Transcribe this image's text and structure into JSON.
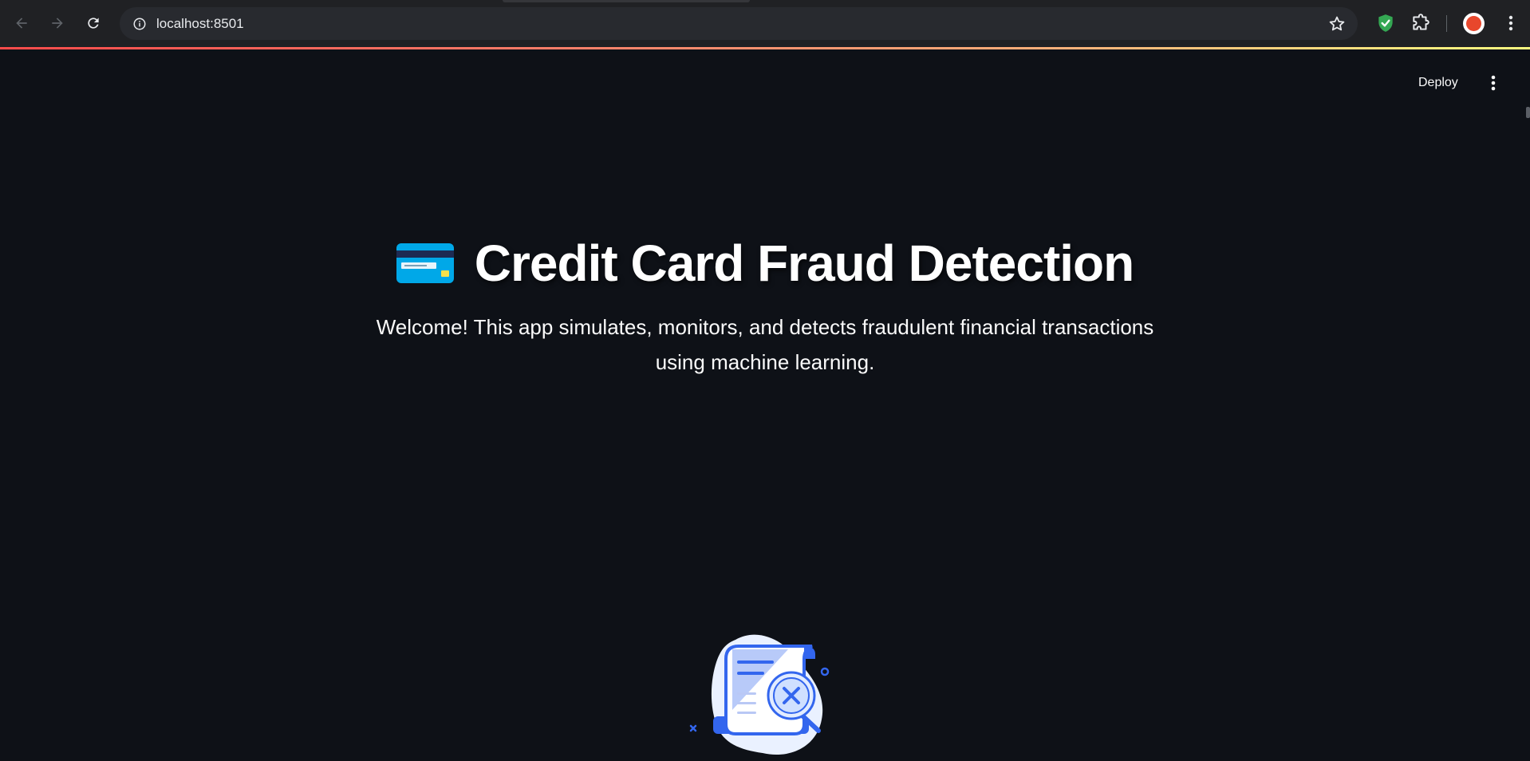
{
  "browser": {
    "url": "localhost:8501",
    "icons": {
      "back": "arrow-left-icon",
      "forward": "arrow-right-icon",
      "reload": "reload-icon",
      "site_info": "info-icon",
      "bookmark": "star-icon",
      "extension_shield": "shield-check-icon",
      "extensions": "puzzle-icon",
      "menu": "kebab-menu-icon"
    },
    "accent_gradient": [
      "#ff4b4b",
      "#ffb27a",
      "#fffd80"
    ]
  },
  "toolbar": {
    "deploy_label": "Deploy",
    "menu_icon": "kebab-menu-icon"
  },
  "hero": {
    "title_icon": "credit-card-icon",
    "title": "Credit Card Fraud Detection",
    "intro": "Welcome! This app simulates, monitors, and detects fraudulent financial transactions using machine learning.",
    "illustration": "fraud-receipt-magnifier-illustration"
  },
  "colors": {
    "app_background": "#0e1117",
    "chrome_background": "#202124",
    "omnibox_background": "#282a2f",
    "text": "#fafafa",
    "illustration_blue": "#3366ee"
  }
}
